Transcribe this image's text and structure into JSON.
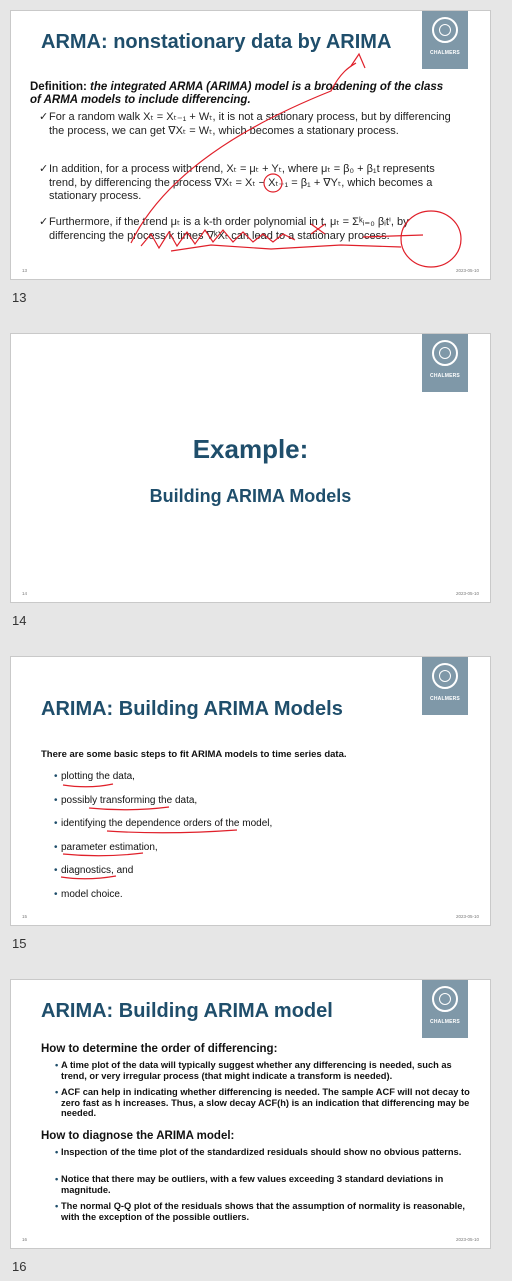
{
  "logo_text": "CHALMERS",
  "slides": [
    {
      "number": "13",
      "footer_num": "13",
      "date": "2023-05-10",
      "title": "ARMA: nonstationary data by ARIMA",
      "definition_lead": "Definition:",
      "definition_body": " the integrated ARMA (ARIMA) model is a broadening of the class of ARMA models to include differencing.",
      "items": [
        "For a random walk Xₜ = Xₜ₋₁ + Wₜ, it is not a stationary process, but by differencing the process, we can get ∇Xₜ = Wₜ, which becomes a stationary process.",
        "In addition, for a process with trend, Xₜ = μₜ + Yₜ, where μₜ = β₀ + β₁t represents trend, by differencing the process ∇Xₜ = Xₜ − Xₜ₋₁ = β₁ + ∇Yₜ, which becomes a stationary process.",
        "Furthermore, if the trend μₜ is a k-th order polynomial in t, μₜ = Σᵏᵢ₌₀ βᵢtⁱ, by differencing the process k times ∇ᵏXₜ can lead to a stationary process."
      ]
    },
    {
      "number": "14",
      "footer_num": "14",
      "date": "2023-05-10",
      "title": "Example:",
      "subtitle": "Building ARIMA Models"
    },
    {
      "number": "15",
      "footer_num": "15",
      "date": "2023-05-10",
      "title": "ARIMA: Building ARIMA Models",
      "intro": "There are some basic steps to fit ARIMA models to time series data.",
      "steps": [
        "plotting the data,",
        "possibly transforming the data,",
        "identifying the dependence orders of the model,",
        "parameter estimation,",
        "diagnostics, and",
        "model choice."
      ]
    },
    {
      "number": "16",
      "footer_num": "16",
      "date": "2023-05-10",
      "title": "ARIMA: Building ARIMA model",
      "heading1": "How to determine the order of differencing:",
      "section1": [
        "A time plot of the data will typically suggest whether any differencing is needed, such as trend, or very irregular process (that might indicate a transform is needed).",
        "ACF can help in indicating whether differencing is needed. The sample ACF will not decay to zero fast as h increases. Thus, a slow decay ACF(h) is an indication that differencing may be needed."
      ],
      "heading2": "How to diagnose the ARIMA model:",
      "section2": [
        "Inspection of the time plot of the standardized residuals should show no obvious patterns.",
        "Notice that there may be outliers, with a few values exceeding 3 standard deviations in magnitude.",
        "The normal Q-Q plot of the residuals shows that the assumption of normality is reasonable, with the exception of the possible outliers."
      ]
    }
  ]
}
